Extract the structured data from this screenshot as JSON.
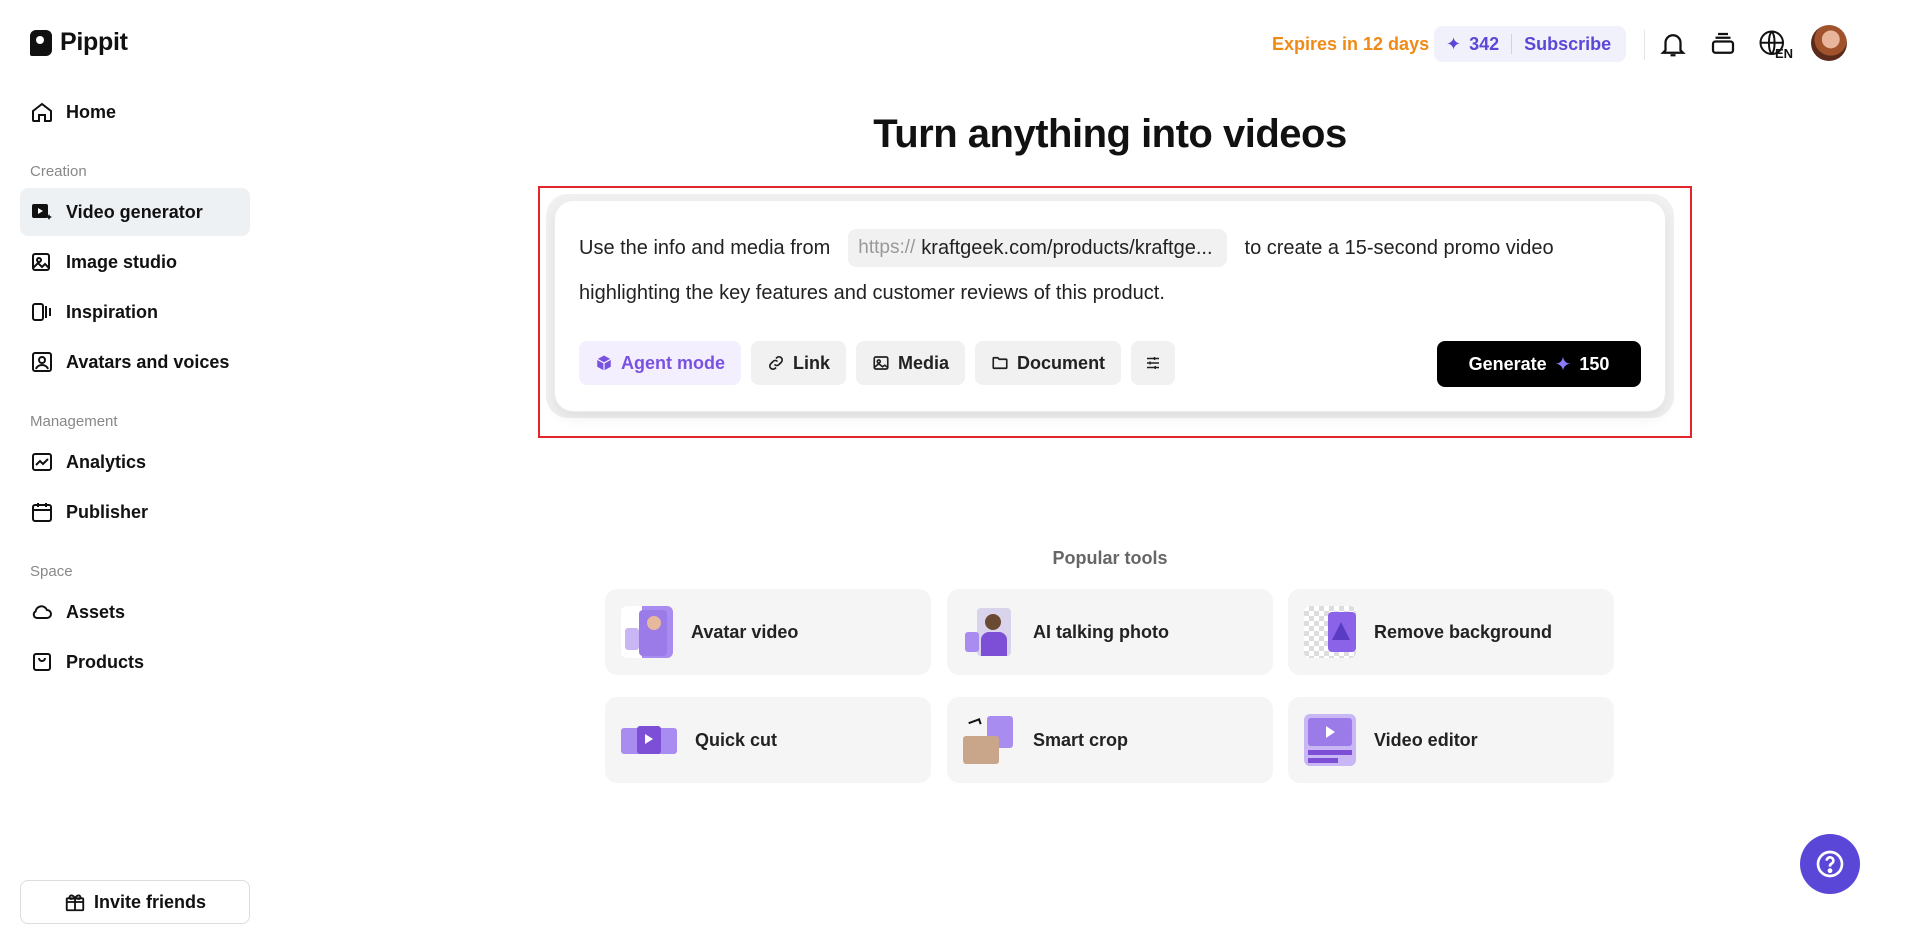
{
  "brand": {
    "name": "Pippit"
  },
  "sidebar": {
    "items_top": [
      {
        "label": "Home",
        "icon": "home-icon"
      }
    ],
    "sections": [
      {
        "label": "Creation",
        "items": [
          {
            "label": "Video generator",
            "icon": "video-generator-icon",
            "active": true
          },
          {
            "label": "Image studio",
            "icon": "image-studio-icon"
          },
          {
            "label": "Inspiration",
            "icon": "inspiration-icon"
          },
          {
            "label": "Avatars and voices",
            "icon": "avatar-voice-icon"
          }
        ]
      },
      {
        "label": "Management",
        "items": [
          {
            "label": "Analytics",
            "icon": "analytics-icon"
          },
          {
            "label": "Publisher",
            "icon": "calendar-icon"
          }
        ]
      },
      {
        "label": "Space",
        "items": [
          {
            "label": "Assets",
            "icon": "cloud-icon"
          },
          {
            "label": "Products",
            "icon": "product-box-icon"
          }
        ]
      }
    ],
    "invite_label": "Invite friends"
  },
  "header": {
    "expires": "Expires in 12 days",
    "credits": "342",
    "subscribe": "Subscribe",
    "lang": "EN"
  },
  "main": {
    "title": "Turn anything into videos",
    "prompt": {
      "prefix": "Use the info and media from",
      "url_protocol": "https://",
      "url": "kraftgeek.com/products/kraftge...",
      "suffix": "to create a 15-second promo video",
      "line2": "highlighting the key features and customer reviews of this product."
    },
    "tools": {
      "agent": "Agent mode",
      "link": "Link",
      "media": "Media",
      "document": "Document"
    },
    "generate": {
      "label": "Generate",
      "cost": "150"
    },
    "popular_label": "Popular tools",
    "popular_tools": [
      {
        "label": "Avatar video"
      },
      {
        "label": "AI talking photo"
      },
      {
        "label": "Remove background"
      },
      {
        "label": "Quick cut"
      },
      {
        "label": "Smart crop"
      },
      {
        "label": "Video editor"
      }
    ]
  },
  "colors": {
    "accent": "#5a47d8",
    "expires": "#f08a17",
    "highlight": "#e0262b"
  }
}
